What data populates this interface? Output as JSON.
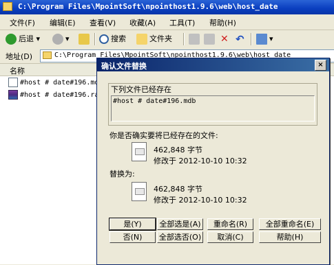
{
  "window": {
    "title": "C:\\Program Files\\MpointSoft\\npointhost1.9.6\\web\\host_date"
  },
  "menu": [
    "文件(F)",
    "编辑(E)",
    "查看(V)",
    "收藏(A)",
    "工具(T)",
    "帮助(H)"
  ],
  "toolbar": {
    "back": "后退",
    "search": "搜索",
    "folders": "文件夹"
  },
  "address": {
    "label": "地址(D)",
    "value": "C:\\Program Files\\MpointSoft\\npointhost1.9.6\\web\\host_date"
  },
  "list": {
    "column_name": "名称",
    "files": [
      {
        "name": "#host # date#196.mdb",
        "icon": "mdb-file-icon"
      },
      {
        "name": "#host # date#196.rar",
        "icon": "rar-file-icon"
      }
    ]
  },
  "dialog": {
    "title": "确认文件替换",
    "close": "×",
    "exists_label": "下列文件已经存在",
    "existing_name": "#host # date#196.mdb",
    "question": "你是否确实要将已经存在的文件:",
    "old_file": {
      "size": "462,848 字节",
      "modified": "修改于 2012-10-10 10:32"
    },
    "replace_with": "替换为:",
    "new_file": {
      "size": "462,848 字节",
      "modified": "修改于 2012-10-10 10:32"
    },
    "buttons": {
      "yes": "是(Y)",
      "yes_all": "全部选是(A)",
      "rename": "重命名(R)",
      "rename_all": "全部重命名(E)",
      "no": "否(N)",
      "no_all": "全部选否(O)",
      "cancel": "取消(C)",
      "help": "帮助(H)"
    }
  },
  "colors": {
    "title_bar": "#0a3ebf",
    "dialog_title": "#0a246a",
    "face": "#ece9d8"
  }
}
